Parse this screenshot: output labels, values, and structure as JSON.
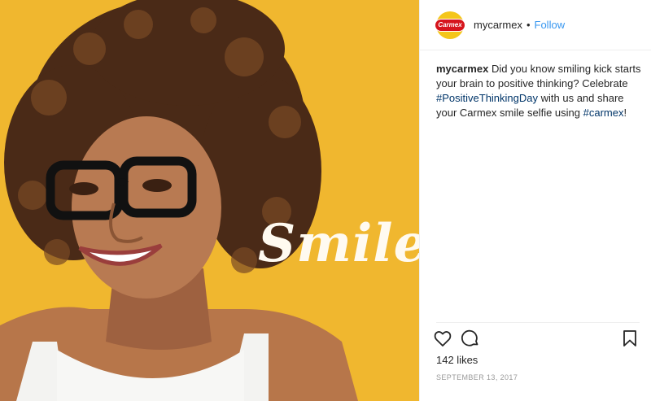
{
  "post": {
    "image": {
      "overlay_text": "Smile",
      "background_color": "#f0b72f"
    },
    "header": {
      "avatar_logo_text": "Carmex",
      "username": "mycarmex",
      "separator": "•",
      "follow_label": "Follow"
    },
    "caption": {
      "username": "mycarmex",
      "text_1": " Did you know smiling kick starts your brain to positive thinking? Celebrate ",
      "hashtag_1": "#PositiveThinkingDay",
      "text_2": " with us and share your Carmex smile selfie using ",
      "hashtag_2": "#carmex",
      "text_3": "!"
    },
    "actions": {
      "like_icon": "heart-icon",
      "comment_icon": "comment-icon",
      "save_icon": "bookmark-icon"
    },
    "likes": "142 likes",
    "date": "SEPTEMBER 13, 2017"
  }
}
